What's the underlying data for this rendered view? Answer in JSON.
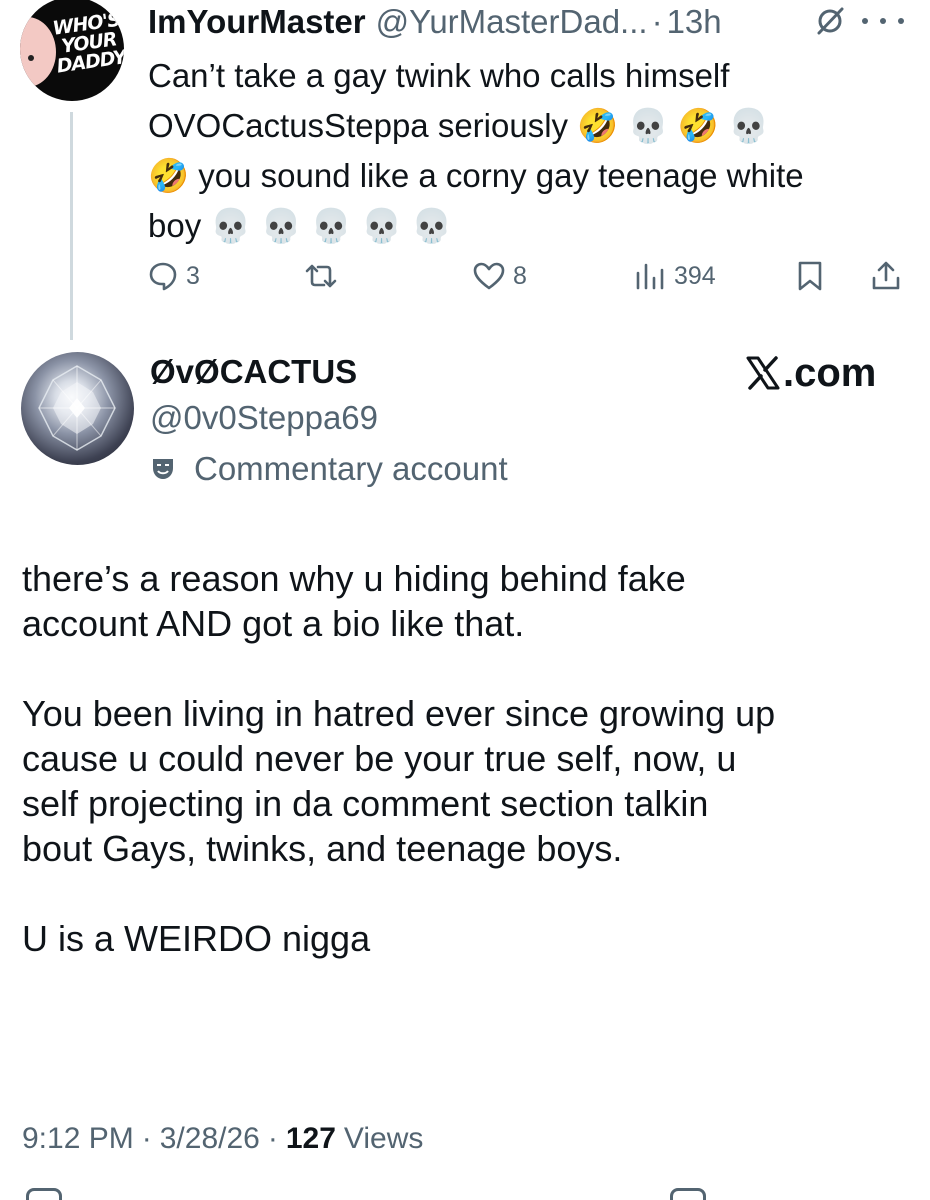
{
  "parent_tweet": {
    "display_name": "ImYourMaster",
    "handle": "@YurMasterDad...",
    "separator": "·",
    "time": "13h",
    "avatar_text": "WHO'S YOUR DADDY?",
    "text_line_1": "Can’t take a gay twink who calls himself",
    "text_line_2": "OVOCactusSteppa seriously 🤣 💀 🤣 💀",
    "text_line_3": "🤣 you sound like a corny gay teenage white",
    "text_line_4": "boy 💀 💀 💀 💀 💀",
    "replies": "3",
    "reposts": "",
    "likes": "8",
    "views": "394"
  },
  "main_tweet": {
    "display_name": "ØvØCACTUS",
    "handle": "@0v0Steppa69",
    "account_label": "Commentary account",
    "watermark": ".com",
    "paragraph_1_line_1": "there’s a reason why u hiding behind  fake",
    "paragraph_1_line_2": "account AND got a bio like that.",
    "paragraph_2_line_1": "You been living in hatred ever since growing up",
    "paragraph_2_line_2": "cause u could never be your true self, now, u",
    "paragraph_2_line_3": "self projecting in da comment section talkin",
    "paragraph_2_line_4": "bout Gays, twinks, and teenage boys.",
    "paragraph_3": "U is a WEIRDO nigga",
    "time": "9:12 PM",
    "separator": "·",
    "date": "3/28/26",
    "views_count": "127",
    "views_label": "Views"
  },
  "icons": {
    "reply": "reply-icon",
    "repost": "repost-icon",
    "like": "heart-icon",
    "views": "views-bar-chart-icon",
    "bookmark": "bookmark-icon",
    "share": "share-icon",
    "grok": "grok-icon",
    "more": "more-dots-icon",
    "label": "theater-mask-icon",
    "x_logo": "x-logo-icon"
  },
  "colors": {
    "text_primary": "#0f1419",
    "text_secondary": "#536471",
    "thread_line": "#cfd9de",
    "background": "#ffffff"
  }
}
